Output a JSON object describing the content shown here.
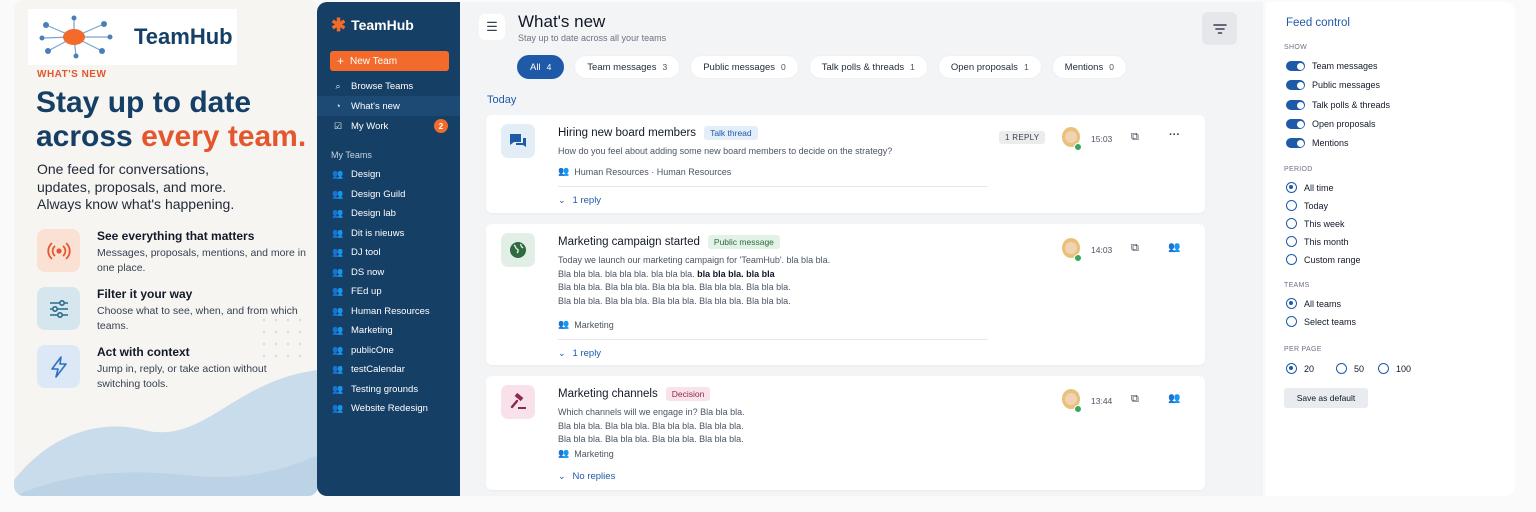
{
  "promo": {
    "logo_text": "TeamHub",
    "eyebrow": "WHAT'S NEW",
    "headline_line1": "Stay up to date",
    "headline_line2_pre": "across ",
    "headline_accent": "every team.",
    "subcopy": "One feed for conversations, updates, proposals, and more. Always know what's happening.",
    "features": [
      {
        "title": "See everything that matters",
        "desc": "Messages, proposals, mentions, and more in one place.",
        "icon": "broadcast-icon",
        "color": "#e4572e"
      },
      {
        "title": "Filter it your way",
        "desc": "Choose what to see, when, and from which teams.",
        "icon": "sliders-icon",
        "color": "#2a6b8a"
      },
      {
        "title": "Act with context",
        "desc": "Jump in, reply, or take action without switching tools.",
        "icon": "bolt-icon",
        "color": "#2f6fbf"
      }
    ]
  },
  "sidebar": {
    "brand": "TeamHub",
    "new_team": "New Team",
    "nav": [
      {
        "label": "Browse Teams",
        "icon": "search-icon"
      },
      {
        "label": "What's new",
        "icon": "rss-icon"
      },
      {
        "label": "My Work",
        "icon": "checkbox-icon",
        "badge": "2"
      }
    ],
    "section_label": "My Teams",
    "teams": [
      "Design",
      "Design Guild",
      "Design lab",
      "Dit is nieuws",
      "DJ tool",
      "DS now",
      "FEd up",
      "Human Resources",
      "Marketing",
      "publicOne",
      "testCalendar",
      "Testing grounds",
      "Website Redesign"
    ]
  },
  "header": {
    "title": "What's new",
    "subtitle": "Stay up to date across all your teams"
  },
  "tabs": [
    {
      "label": "All",
      "count": "4"
    },
    {
      "label": "Team messages",
      "count": "3"
    },
    {
      "label": "Public messages",
      "count": "0"
    },
    {
      "label": "Talk polls & threads",
      "count": "1"
    },
    {
      "label": "Open proposals",
      "count": "1"
    },
    {
      "label": "Mentions",
      "count": "0"
    }
  ],
  "day_label": "Today",
  "cards": [
    {
      "title": "Hiring new board members",
      "tag": "Talk thread",
      "body": "How do you feel about adding some new board members to decide on the strategy?",
      "meta": "Human Resources · Human Resources",
      "reply_pill": "1 REPLY",
      "time": "15:03",
      "replies": "1 reply"
    },
    {
      "title": "Marketing campaign started",
      "tag": "Public message",
      "body_line1": "Today we launch our marketing campaign for 'TeamHub'. bla bla bla.",
      "body_line2_pre": "Bla bla bla. bla bla bla. bla bla bla. ",
      "body_line2_bold": "bla bla bla. bla bla",
      "body_line3": "Bla bla bla. Bla bla bla. Bla bla bla. Bla bla bla. Bla bla bla.",
      "body_line4": "Bla bla bla. Bla bla bla. Bla bla bla. Bla bla bla. Bla bla bla.",
      "meta": "Marketing",
      "time": "14:03",
      "replies": "1 reply"
    },
    {
      "title": "Marketing channels",
      "tag": "Decision",
      "body_line1": "Which channels will we engage in? Bla bla bla.",
      "body_line2": "Bla bla bla. Bla bla bla. Bla bla bla. Bla bla bla.",
      "body_line3": "Bla bla bla. Bla bla bla. Bla bla bla. Bla bla bla.",
      "meta": "Marketing",
      "time": "13:44",
      "replies": "No replies"
    }
  ],
  "panel": {
    "title": "Feed control",
    "show_label": "SHOW",
    "show_items": [
      "Team messages",
      "Public messages",
      "Talk polls & threads",
      "Open proposals",
      "Mentions"
    ],
    "period_label": "PERIOD",
    "period_items": [
      "All time",
      "Today",
      "This week",
      "This month",
      "Custom range"
    ],
    "period_selected": "All time",
    "teams_label": "TEAMS",
    "teams_items": [
      "All teams",
      "Select teams"
    ],
    "teams_selected": "All teams",
    "perpage_label": "PER PAGE",
    "perpage_items": [
      "20",
      "50",
      "100"
    ],
    "perpage_selected": "20",
    "save_label": "Save as default"
  },
  "colors": {
    "brand_navy": "#163f66",
    "accent_orange": "#f26b2a",
    "primary_blue": "#1e5aa8"
  }
}
